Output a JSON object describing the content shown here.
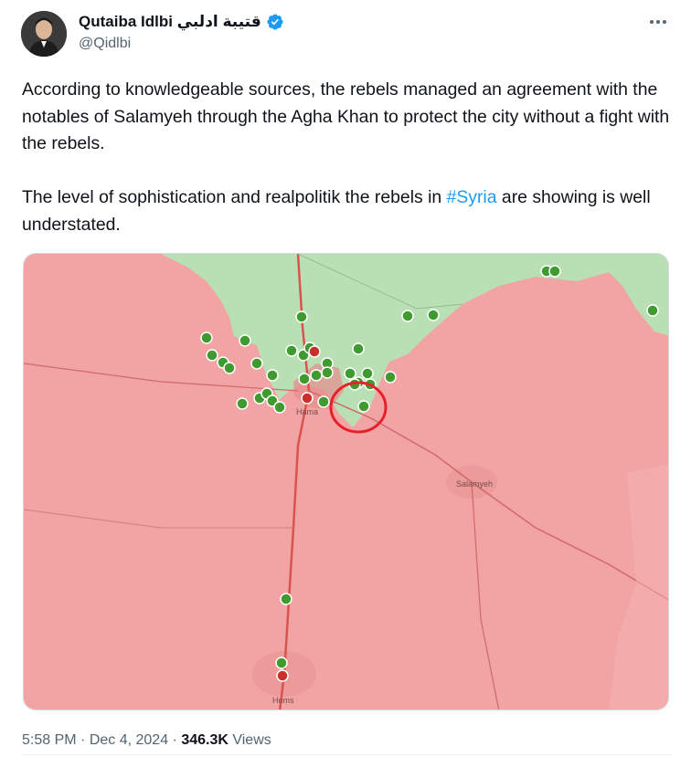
{
  "author": {
    "name": "Qutaiba Idlbi قتيبة ادلبي",
    "handle": "@Qidlbi"
  },
  "tweet": {
    "paragraph1": "According to knowledgeable sources, the rebels managed an agreement with the notables of Salamyeh through the Agha Khan to protect the city without a fight with the rebels.",
    "paragraph2_before": "The level of sophistication and realpolitik the rebels in ",
    "hashtag": "#Syria",
    "paragraph2_after": " are showing is well understated."
  },
  "map": {
    "rebel_color": "#b5e3b0",
    "government_color": "#f2a3a3",
    "highlight_color": "#e8202a",
    "city_labels": {
      "hama": "Hama",
      "salamyeh": "Salamyeh",
      "homs": "Homs"
    }
  },
  "meta": {
    "time": "5:58 PM",
    "separator": " · ",
    "date": "Dec 4, 2024",
    "views_count": "346.3K",
    "views_label": "Views"
  },
  "icons": {
    "verified": "verified-badge-icon",
    "more": "more-options-icon",
    "rebel_marker": "green-military-marker-icon",
    "gov_marker": "red-military-marker-icon"
  }
}
